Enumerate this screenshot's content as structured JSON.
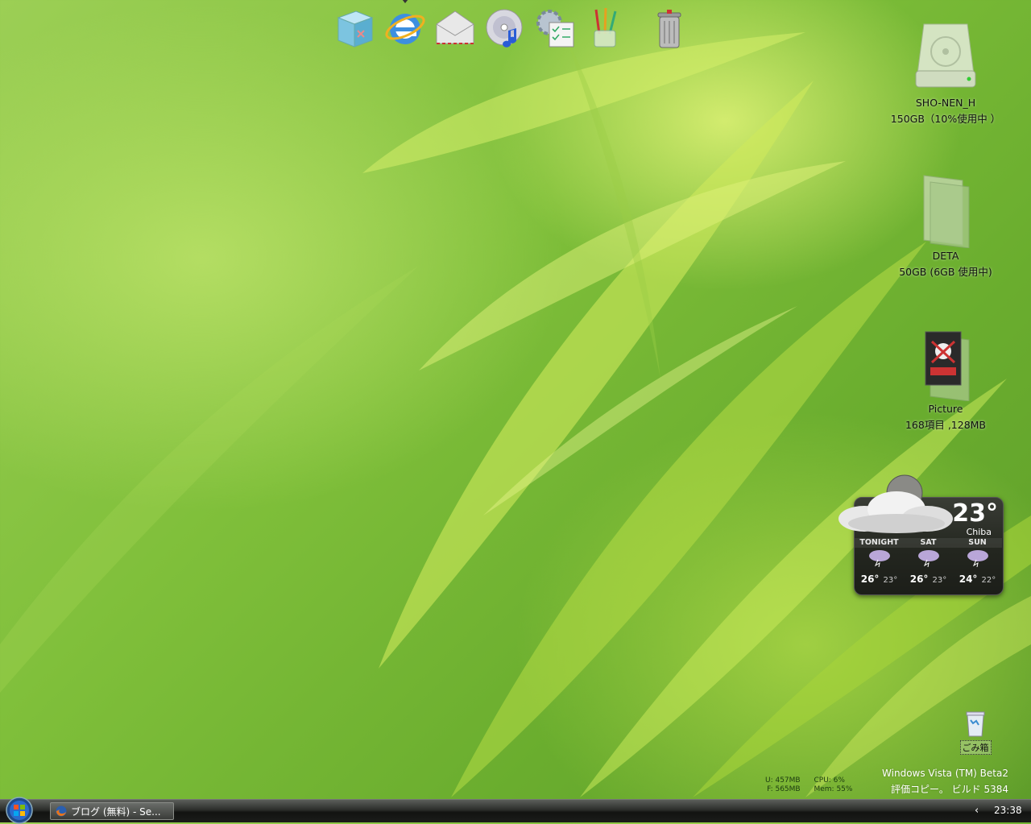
{
  "dock": {
    "items": [
      {
        "name": "finder-box"
      },
      {
        "name": "internet-explorer",
        "running": true
      },
      {
        "name": "mail"
      },
      {
        "name": "itunes-cd"
      },
      {
        "name": "system-preferences"
      },
      {
        "name": "pencil-cup"
      },
      {
        "name": "trash-can"
      }
    ]
  },
  "desktop_icons": {
    "drive1": {
      "name": "SHO-NEN_H",
      "info": "150GB（10%使用中 ）"
    },
    "drive2": {
      "name": "DETA",
      "info": "50GB (6GB 使用中)"
    },
    "picture": {
      "name": "Picture",
      "info": "168項目 ,128MB"
    }
  },
  "weather": {
    "temp": "23°",
    "city": "Chiba",
    "forecast": [
      {
        "day": "TONIGHT",
        "hi": "26°",
        "lo": "23°"
      },
      {
        "day": "SAT",
        "hi": "26°",
        "lo": "23°"
      },
      {
        "day": "SUN",
        "hi": "24°",
        "lo": "22°"
      }
    ]
  },
  "recycle_bin": {
    "label": "ごみ箱"
  },
  "sysmon": {
    "u": "U: 457MB",
    "f": "F: 565MB",
    "cpu": "CPU:  6%",
    "mem": "Mem: 55%"
  },
  "watermark": {
    "line1": "Windows Vista (TM) Beta2",
    "line2": "評価コピー。 ビルド 5384"
  },
  "taskbar": {
    "task_label": "ブログ (無料) - Se...",
    "tray_arrow": "‹",
    "clock": "23:38"
  },
  "colors": {
    "accent": "#8cc63f",
    "taskbar": "#1b1c1a"
  }
}
